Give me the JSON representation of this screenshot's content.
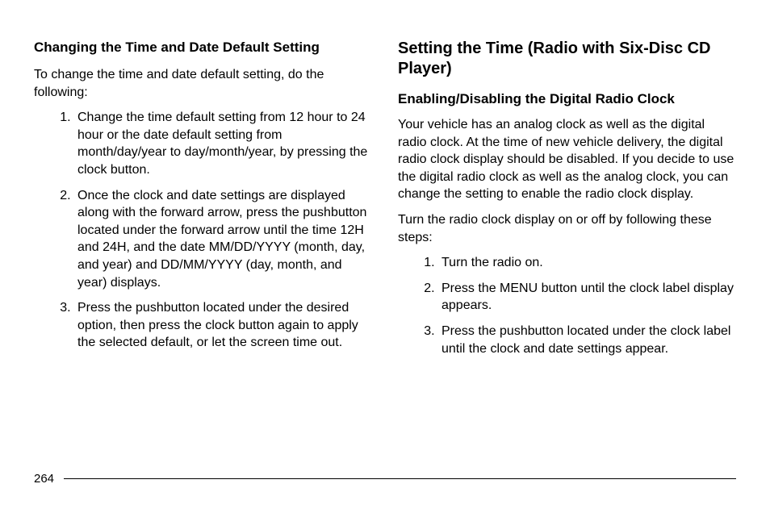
{
  "left": {
    "heading": "Changing the Time and Date Default Setting",
    "intro": "To change the time and date default setting, do the following:",
    "steps": [
      "Change the time default setting from 12 hour to 24 hour or the date default setting from month/day/year to day/month/year, by pressing the clock button.",
      "Once the clock and date settings are displayed along with the forward arrow, press the pushbutton located under the forward arrow until the time 12H and 24H, and the date MM/DD/YYYY (month, day, and year) and DD/MM/YYYY (day, month, and year) displays.",
      "Press the pushbutton located under the desired option, then press the clock button again to apply the selected default, or let the screen time out."
    ]
  },
  "right": {
    "heading": "Setting the Time (Radio with Six-Disc CD Player)",
    "sub_heading": "Enabling/Disabling the Digital Radio Clock",
    "para1": "Your vehicle has an analog clock as well as the digital radio clock. At the time of new vehicle delivery, the digital radio clock display should be disabled. If you decide to use the digital radio clock as well as the analog clock, you can change the setting to enable the radio clock display.",
    "para2": "Turn the radio clock display on or off by following these steps:",
    "steps": [
      "Turn the radio on.",
      "Press the MENU button until the clock label display appears.",
      "Press the pushbutton located under the clock label until the clock and date settings appear."
    ]
  },
  "page_number": "264"
}
